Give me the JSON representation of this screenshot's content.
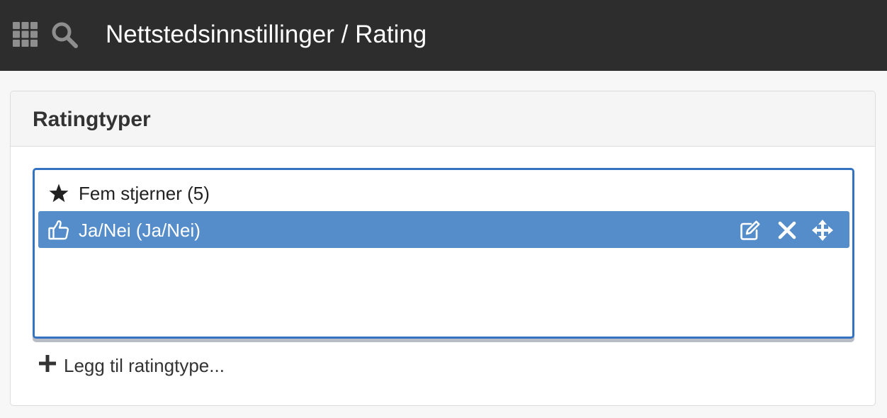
{
  "header": {
    "title": "Nettstedsinnstillinger / Rating",
    "apps_icon": "apps-grid-icon",
    "search_icon": "search-icon"
  },
  "panel": {
    "title": "Ratingtyper",
    "items": [
      {
        "label": "Fem stjerner (5)",
        "icon": "star-icon",
        "selected": false
      },
      {
        "label": "Ja/Nei (Ja/Nei)",
        "icon": "thumbs-up-icon",
        "selected": true,
        "actions": [
          "edit-icon",
          "delete-icon",
          "move-icon"
        ]
      }
    ],
    "add_label": "Legg til ratingtype..."
  },
  "colors": {
    "topbar": "#2d2d2d",
    "selected_item": "#548dc9",
    "focus_border": "#3472c2"
  }
}
